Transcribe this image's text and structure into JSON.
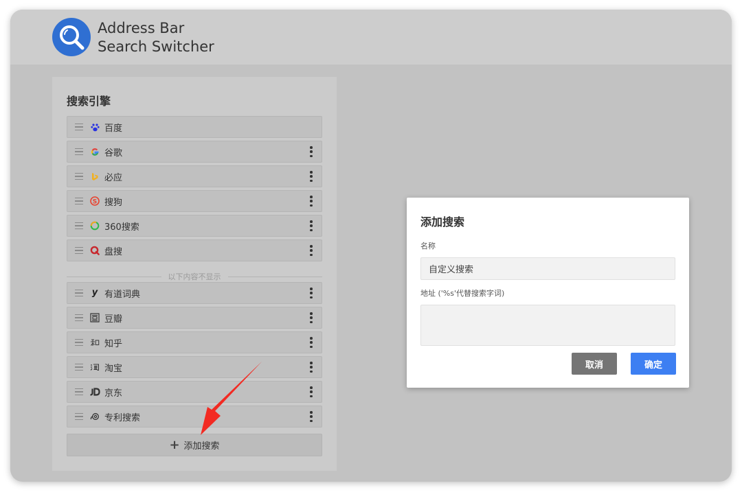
{
  "app": {
    "title_line1": "Address Bar",
    "title_line2": "Search Switcher",
    "logo_icon": "search-icon",
    "brand_color": "#2f6fd2"
  },
  "panel": {
    "title": "搜索引擎",
    "divider_text": "以下内容不显示",
    "add_label": "添加搜索",
    "add_icon": "plus-icon",
    "visible_engines": [
      {
        "label": "百度",
        "icon": "baidu-paw-icon",
        "color": "#2932e1",
        "has_menu": false
      },
      {
        "label": "谷歌",
        "icon": "google-g-icon",
        "color": "#4285f4",
        "has_menu": true
      },
      {
        "label": "必应",
        "icon": "bing-icon",
        "color": "#f2b01e",
        "has_menu": true
      },
      {
        "label": "搜狗",
        "icon": "sogou-icon",
        "color": "#e8422f",
        "has_menu": true
      },
      {
        "label": "360搜索",
        "icon": "360-icon",
        "color": "#2db84b",
        "has_menu": true
      },
      {
        "label": "盘搜",
        "icon": "pansou-q-icon",
        "color": "#c8272d",
        "has_menu": true
      }
    ],
    "hidden_engines": [
      {
        "label": "有道词典",
        "icon": "youdao-y-icon",
        "color": "#222222",
        "has_menu": true
      },
      {
        "label": "豆瓣",
        "icon": "douban-icon",
        "color": "#333333",
        "has_menu": true
      },
      {
        "label": "知乎",
        "icon": "zhihu-icon",
        "color": "#444444",
        "has_menu": true
      },
      {
        "label": "淘宝",
        "icon": "taobao-icon",
        "color": "#333333",
        "has_menu": true
      },
      {
        "label": "京东",
        "icon": "jd-icon",
        "color": "#333333",
        "has_menu": true
      },
      {
        "label": "专利搜索",
        "icon": "patent-icon",
        "color": "#333333",
        "has_menu": true
      }
    ]
  },
  "dialog": {
    "title": "添加搜索",
    "name_label": "名称",
    "name_value": "自定义搜索",
    "url_label": "地址 ('%s'代替搜索字词)",
    "url_value": "",
    "cancel_label": "取消",
    "ok_label": "确定",
    "ok_color": "#3d7ff2",
    "cancel_color": "#757575"
  },
  "annotation": {
    "arrow_color": "#f22a22"
  }
}
